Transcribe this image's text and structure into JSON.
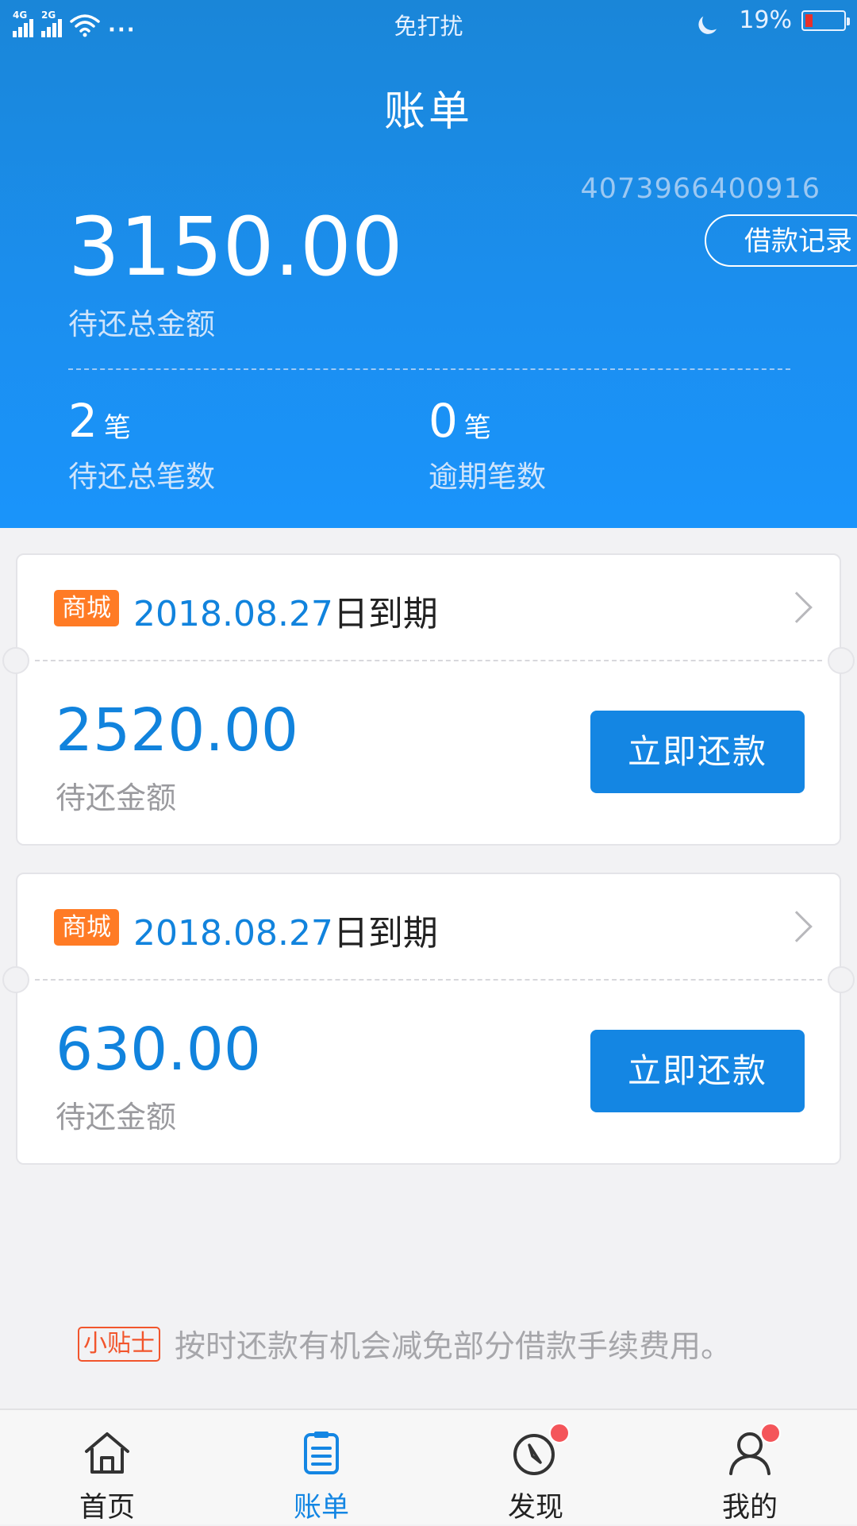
{
  "status_bar": {
    "signal1": "4G",
    "signal2": "2G",
    "more": "···",
    "center": "免打扰",
    "battery": "19%",
    "battery_level": 0.19
  },
  "header": {
    "title": "账单",
    "account_number": "4073966400916",
    "record_button": "借款记录",
    "total_amount": "3150.00",
    "total_label": "待还总金额",
    "pending_count": "2",
    "pending_unit": "笔",
    "pending_label": "待还总笔数",
    "overdue_count": "0",
    "overdue_unit": "笔",
    "overdue_label": "逾期笔数"
  },
  "bills": [
    {
      "tag": "商城",
      "due_date": "2018.08.27",
      "due_suffix": "日到期",
      "amount": "2520.00",
      "amount_label": "待还金额",
      "repay_button": "立即还款"
    },
    {
      "tag": "商城",
      "due_date": "2018.08.27",
      "due_suffix": "日到期",
      "amount": "630.00",
      "amount_label": "待还金额",
      "repay_button": "立即还款"
    }
  ],
  "tip": {
    "tag": "小贴士",
    "text": "按时还款有机会减免部分借款手续费用。"
  },
  "nav": {
    "items": [
      {
        "label": "首页",
        "icon": "home-icon"
      },
      {
        "label": "账单",
        "icon": "bill-icon"
      },
      {
        "label": "发现",
        "icon": "compass-icon"
      },
      {
        "label": "我的",
        "icon": "user-icon"
      }
    ]
  },
  "colors": {
    "primary": "#1486e3",
    "header_blue": "#1b8ff0",
    "tag_orange": "#ff7b25",
    "tip_red": "#f2552c",
    "badge_red": "#f4555a"
  }
}
